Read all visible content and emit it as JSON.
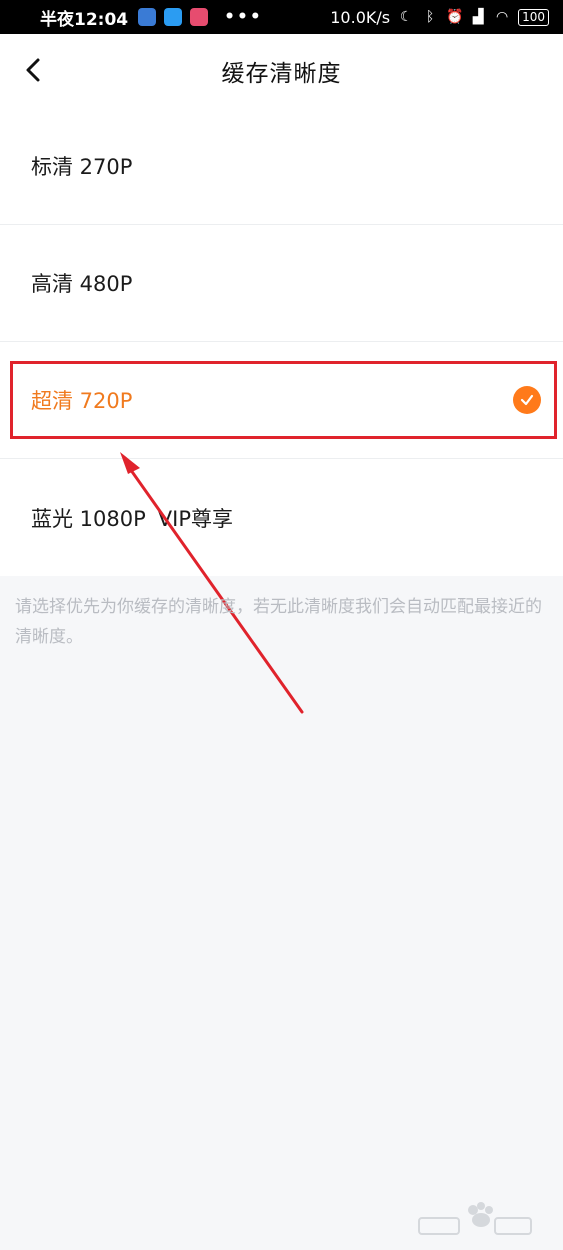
{
  "status_bar": {
    "time": "半夜12:04",
    "dots": "•••",
    "network_speed": "10.0K/s",
    "battery": "100"
  },
  "header": {
    "title": "缓存清晰度"
  },
  "options": [
    {
      "label": "标清 270P",
      "badge": "",
      "selected": false
    },
    {
      "label": "高清 480P",
      "badge": "",
      "selected": false
    },
    {
      "label": "超清 720P",
      "badge": "",
      "selected": true
    },
    {
      "label": "蓝光 1080P",
      "badge": "VIP尊享",
      "selected": false
    }
  ],
  "note": "请选择优先为你缓存的清晰度，若无此清晰度我们会自动匹配最接近的清晰度。",
  "colors": {
    "accent": "#f07a1e",
    "check": "#ff7a1a",
    "annotation": "#e0232c",
    "background": "#f6f7f9"
  }
}
